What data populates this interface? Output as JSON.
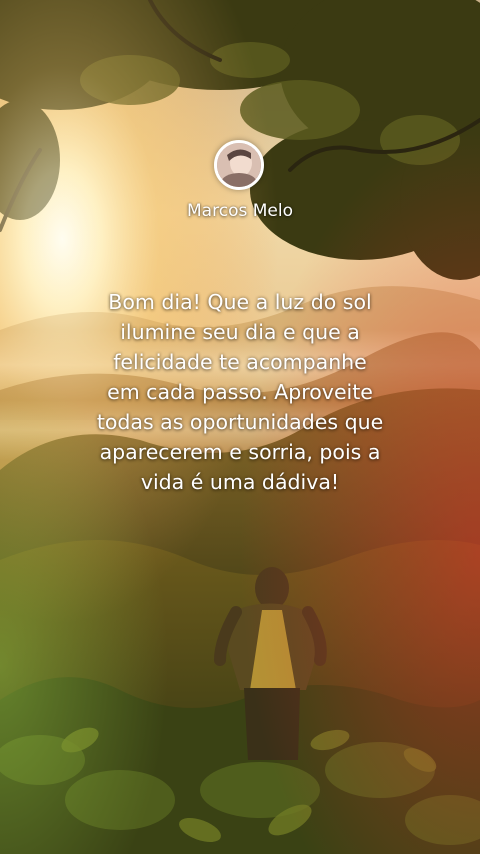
{
  "post": {
    "author_name": "Marcos Melo",
    "message": "Bom dia! Que a luz do sol ilumine seu dia e que a felicidade te acompanhe em cada passo. Aproveite todas as oportunidades que aparecerem e sorria, pois a vida é uma dádiva!"
  },
  "colors": {
    "text": "#ffffff",
    "sun": "#fff4cf",
    "foliage": "#2f3e14",
    "warm_glow": "#f2a63a"
  }
}
